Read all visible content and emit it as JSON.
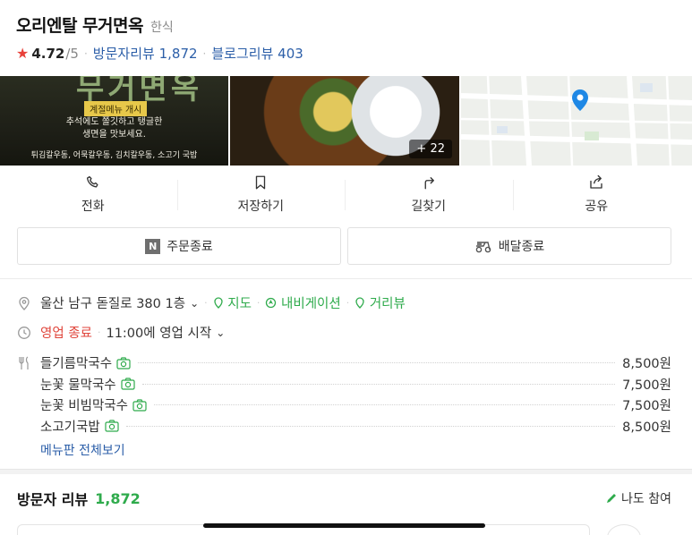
{
  "place": {
    "name": "오리엔탈 무거면옥",
    "category": "한식",
    "rating": "4.72",
    "rating_max": "/5",
    "visitor_reviews_label": "방문자리뷰",
    "visitor_reviews_count": "1,872",
    "blog_reviews_label": "블로그리뷰",
    "blog_reviews_count": "403"
  },
  "photos": {
    "photo1_heading": "무거면옥",
    "photo1_tag": "계절메뉴 개시",
    "photo1_line1": "추석에도 쫄깃하고 탱글한",
    "photo1_line2": "생면을 맛보세요.",
    "photo1_line3": "튀김칼우동, 어묵칼우동, 김치칼우동, 소고기 국밥",
    "more_count": "+ 22"
  },
  "actions": [
    {
      "label": "전화",
      "icon": "phone-icon"
    },
    {
      "label": "저장하기",
      "icon": "bookmark-icon"
    },
    {
      "label": "길찾기",
      "icon": "directions-icon"
    },
    {
      "label": "공유",
      "icon": "share-icon"
    }
  ],
  "buttons": {
    "order": "주문종료",
    "delivery": "배달종료"
  },
  "address": {
    "text": "울산 남구 돋질로 380 1층",
    "map_link": "지도",
    "navigation_link": "내비게이션",
    "street_view_link": "거리뷰"
  },
  "hours": {
    "status": "영업 종료",
    "next": "11:00에 영업 시작"
  },
  "menu": {
    "items": [
      {
        "name": "들기름막국수",
        "price": "8,500원"
      },
      {
        "name": "눈꽃 물막국수",
        "price": "7,500원"
      },
      {
        "name": "눈꽃 비빔막국수",
        "price": "7,500원"
      },
      {
        "name": "소고기국밥",
        "price": "8,500원"
      }
    ],
    "more_label": "메뉴판 전체보기"
  },
  "reviews": {
    "title": "방문자 리뷰",
    "count": "1,872",
    "participate": "나도 참여"
  },
  "colors": {
    "accent_green": "#2fab4c",
    "link_blue": "#2b5ea8",
    "closed_red": "#e0463c",
    "star_red": "#e8413a"
  }
}
